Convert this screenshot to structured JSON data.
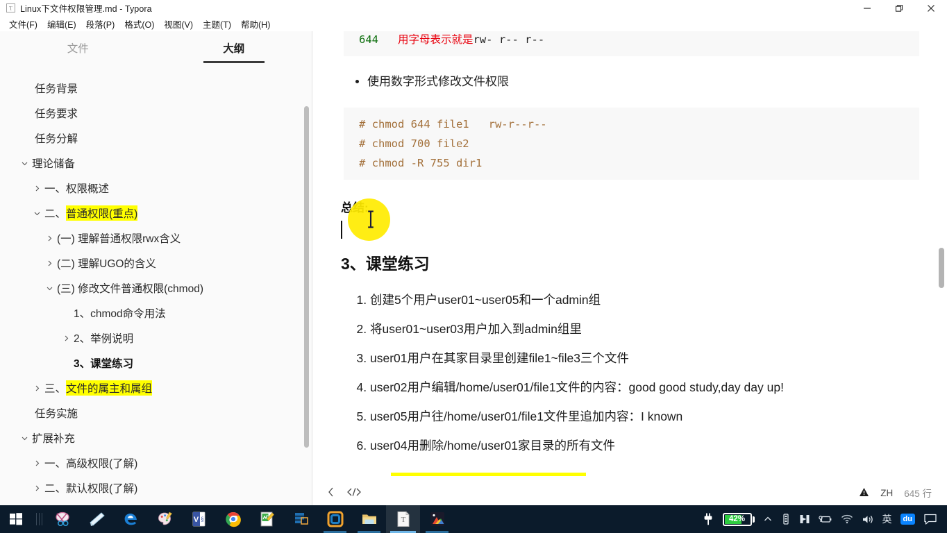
{
  "window": {
    "app_icon": "typora-icon",
    "title": "Linux下文件权限管理.md - Typora",
    "minimize_label": "—",
    "maximize_label": "❐",
    "close_label": "✕"
  },
  "menubar": {
    "items": [
      {
        "label": "文件(F)",
        "name": "menu-file"
      },
      {
        "label": "编辑(E)",
        "name": "menu-edit"
      },
      {
        "label": "段落(P)",
        "name": "menu-paragraph"
      },
      {
        "label": "格式(O)",
        "name": "menu-format"
      },
      {
        "label": "视图(V)",
        "name": "menu-view"
      },
      {
        "label": "主题(T)",
        "name": "menu-theme"
      },
      {
        "label": "帮助(H)",
        "name": "menu-help"
      }
    ]
  },
  "sidebar": {
    "tabs": [
      {
        "label": "文件",
        "active": false
      },
      {
        "label": "大纲",
        "active": true
      }
    ],
    "outline": [
      {
        "label": "任务背景",
        "level": 0,
        "arrow": "none",
        "highlight": false,
        "bold": false
      },
      {
        "label": "任务要求",
        "level": 0,
        "arrow": "none",
        "highlight": false,
        "bold": false
      },
      {
        "label": "任务分解",
        "level": 0,
        "arrow": "none",
        "highlight": false,
        "bold": false
      },
      {
        "label": "理论储备",
        "level": 1,
        "arrow": "down",
        "highlight": false,
        "bold": false
      },
      {
        "label": "一、权限概述",
        "level": 2,
        "arrow": "right",
        "highlight": false,
        "bold": false
      },
      {
        "label": "二、",
        "level": 2,
        "arrow": "down",
        "highlight": false,
        "bold": false,
        "hl_label": "普通权限(重点)"
      },
      {
        "label": "(一) 理解普通权限rwx含义",
        "level": 3,
        "arrow": "right",
        "highlight": false,
        "bold": false
      },
      {
        "label": "(二) 理解UGO的含义",
        "level": 3,
        "arrow": "right",
        "highlight": false,
        "bold": false
      },
      {
        "label": "(三) 修改文件普通权限(chmod)",
        "level": 3,
        "arrow": "down",
        "highlight": false,
        "bold": false
      },
      {
        "label": "1、chmod命令用法",
        "level": 4,
        "arrow": "none",
        "highlight": false,
        "bold": false
      },
      {
        "label": "2、举例说明",
        "level": 4,
        "arrow": "right",
        "highlight": false,
        "bold": false
      },
      {
        "label": "3、课堂练习",
        "level": 4,
        "arrow": "none",
        "highlight": false,
        "bold": true
      },
      {
        "label": "三、",
        "level": 2,
        "arrow": "right",
        "highlight": false,
        "bold": false,
        "hl_label": "文件的属主和属组"
      },
      {
        "label": "任务实施",
        "level": 0,
        "arrow": "none",
        "highlight": false,
        "bold": false
      },
      {
        "label": "扩展补充",
        "level": 1,
        "arrow": "down",
        "highlight": false,
        "bold": false
      },
      {
        "label": "一、高级权限(了解)",
        "level": 2,
        "arrow": "right",
        "highlight": false,
        "bold": false
      },
      {
        "label": "二、默认权限(了解)",
        "level": 2,
        "arrow": "right",
        "highlight": false,
        "bold": false
      }
    ]
  },
  "editor": {
    "code_block_top": {
      "mode": "644",
      "note_cn": "用字母表示就是",
      "note_perm": "rw- r-- r--"
    },
    "bullets": [
      "使用数字形式修改文件权限"
    ],
    "code_block_main": [
      "# chmod 644 file1   rw-r--r--",
      "# chmod 700 file2",
      "# chmod -R 755 dir1"
    ],
    "summary_label": "总结:",
    "heading": "3、课堂练习",
    "exercises": [
      "创建5个用户user01~user05和一个admin组",
      "将user01~user03用户加入到admin组里",
      "user01用户在其家目录里创建file1~file3三个文件",
      "user02用户编辑/home/user01/file1文件的内容：good good study,day day up!",
      "user05用户往/home/user01/file1文件里追加内容：I known",
      "user04用删除/home/user01家目录的所有文件"
    ]
  },
  "statusbar": {
    "back_icon": "chevron-left-icon",
    "source_icon": "source-code-icon",
    "warning_icon": "warning-triangle-icon",
    "language": "ZH",
    "line_count": "645 行"
  },
  "taskbar": {
    "start_label": "start-button",
    "apps": [
      {
        "name": "taskbar-snipping-tool",
        "icon": "snipping-tool-icon"
      },
      {
        "name": "taskbar-sticky-notes",
        "icon": "sticky-notes-icon"
      },
      {
        "name": "taskbar-edge",
        "icon": "edge-icon"
      },
      {
        "name": "taskbar-paint",
        "icon": "paint-icon"
      },
      {
        "name": "taskbar-visio",
        "icon": "visio-icon"
      },
      {
        "name": "taskbar-chrome",
        "icon": "chrome-icon"
      },
      {
        "name": "taskbar-editor",
        "icon": "text-editor-icon"
      },
      {
        "name": "taskbar-xshell",
        "icon": "xshell-icon"
      },
      {
        "name": "taskbar-vmware",
        "icon": "vmware-icon"
      },
      {
        "name": "taskbar-file-explorer",
        "icon": "folder-icon"
      },
      {
        "name": "taskbar-typora",
        "icon": "typora-icon"
      },
      {
        "name": "taskbar-photos",
        "icon": "photos-icon"
      }
    ],
    "tray": {
      "power_icon": "power-plug-icon",
      "battery_percent": "42%",
      "chevron_label": "˄",
      "icons": [
        "usb-icon",
        "vmware-tray-icon",
        "battery-tray-icon",
        "wifi-icon",
        "volume-icon"
      ],
      "ime_label": "英",
      "ime_badge": "du",
      "action_center_icon": "action-center-icon"
    }
  },
  "colors": {
    "accent": "#3a3a3a",
    "highlight": "#ffff00",
    "code_brown": "#a3703a",
    "code_red": "#e8000d",
    "code_green": "#107010",
    "taskbar_bg": "#0b1b2b",
    "battery_green": "#2ecc40"
  }
}
